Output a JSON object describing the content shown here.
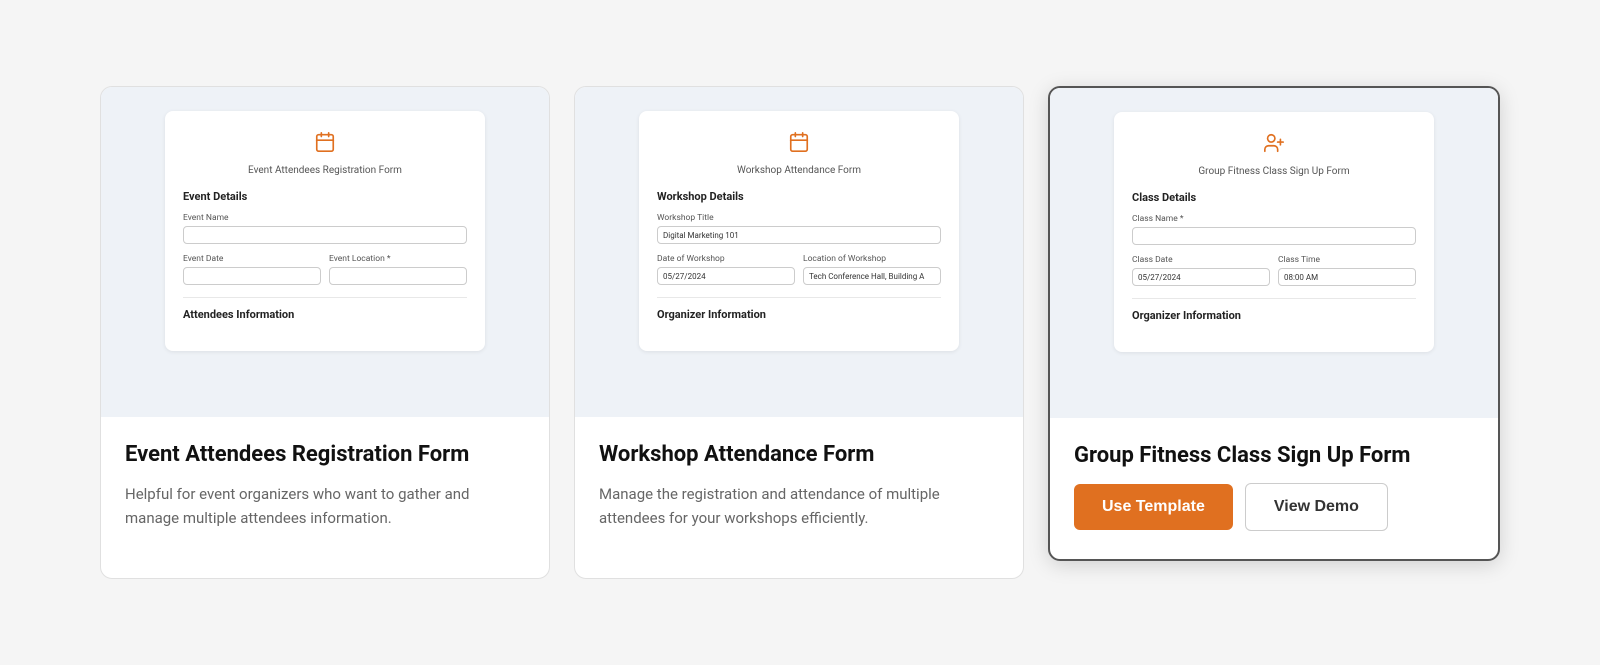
{
  "cards": [
    {
      "id": "event-registration",
      "preview": {
        "icon": "📅",
        "title": "Event Attendees Registration Form",
        "sections": [
          {
            "heading": "Event Details",
            "fields": [
              {
                "label": "Event Name",
                "value": "",
                "fullWidth": true
              },
              {
                "row": [
                  {
                    "label": "Event Date",
                    "value": ""
                  },
                  {
                    "label": "Event Location *",
                    "value": ""
                  }
                ]
              }
            ]
          },
          {
            "heading": "Attendees Information",
            "fields": []
          }
        ]
      },
      "title": "Event Attendees Registration Form",
      "description": "Helpful for event organizers who want to gather and manage multiple attendees information.",
      "selected": false,
      "actions": []
    },
    {
      "id": "workshop-attendance",
      "preview": {
        "icon": "📅",
        "title": "Workshop Attendance Form",
        "sections": [
          {
            "heading": "Workshop Details",
            "fields": [
              {
                "label": "Workshop Title",
                "value": "Digital Marketing 101",
                "fullWidth": true
              },
              {
                "row": [
                  {
                    "label": "Date of Workshop",
                    "value": "05/27/2024"
                  },
                  {
                    "label": "Location of Workshop",
                    "value": "Tech Conference Hall, Building A"
                  }
                ]
              }
            ]
          },
          {
            "heading": "Organizer Information",
            "fields": []
          }
        ]
      },
      "title": "Workshop Attendance Form",
      "description": "Manage the registration and attendance of multiple attendees for your workshops efficiently.",
      "selected": false,
      "actions": []
    },
    {
      "id": "group-fitness",
      "preview": {
        "icon": "👤+",
        "title": "Group Fitness Class Sign Up Form",
        "sections": [
          {
            "heading": "Class Details",
            "fields": [
              {
                "label": "Class Name *",
                "value": "",
                "fullWidth": true
              },
              {
                "row": [
                  {
                    "label": "Class Date",
                    "value": "05/27/2024"
                  },
                  {
                    "label": "Class Time",
                    "value": "08:00 AM"
                  }
                ]
              }
            ]
          },
          {
            "heading": "Organizer Information",
            "fields": []
          }
        ]
      },
      "title": "Group Fitness Class Sign Up Form",
      "description": "",
      "selected": true,
      "actions": [
        {
          "type": "primary",
          "label": "Use Template"
        },
        {
          "type": "secondary",
          "label": "View Demo"
        }
      ]
    }
  ]
}
